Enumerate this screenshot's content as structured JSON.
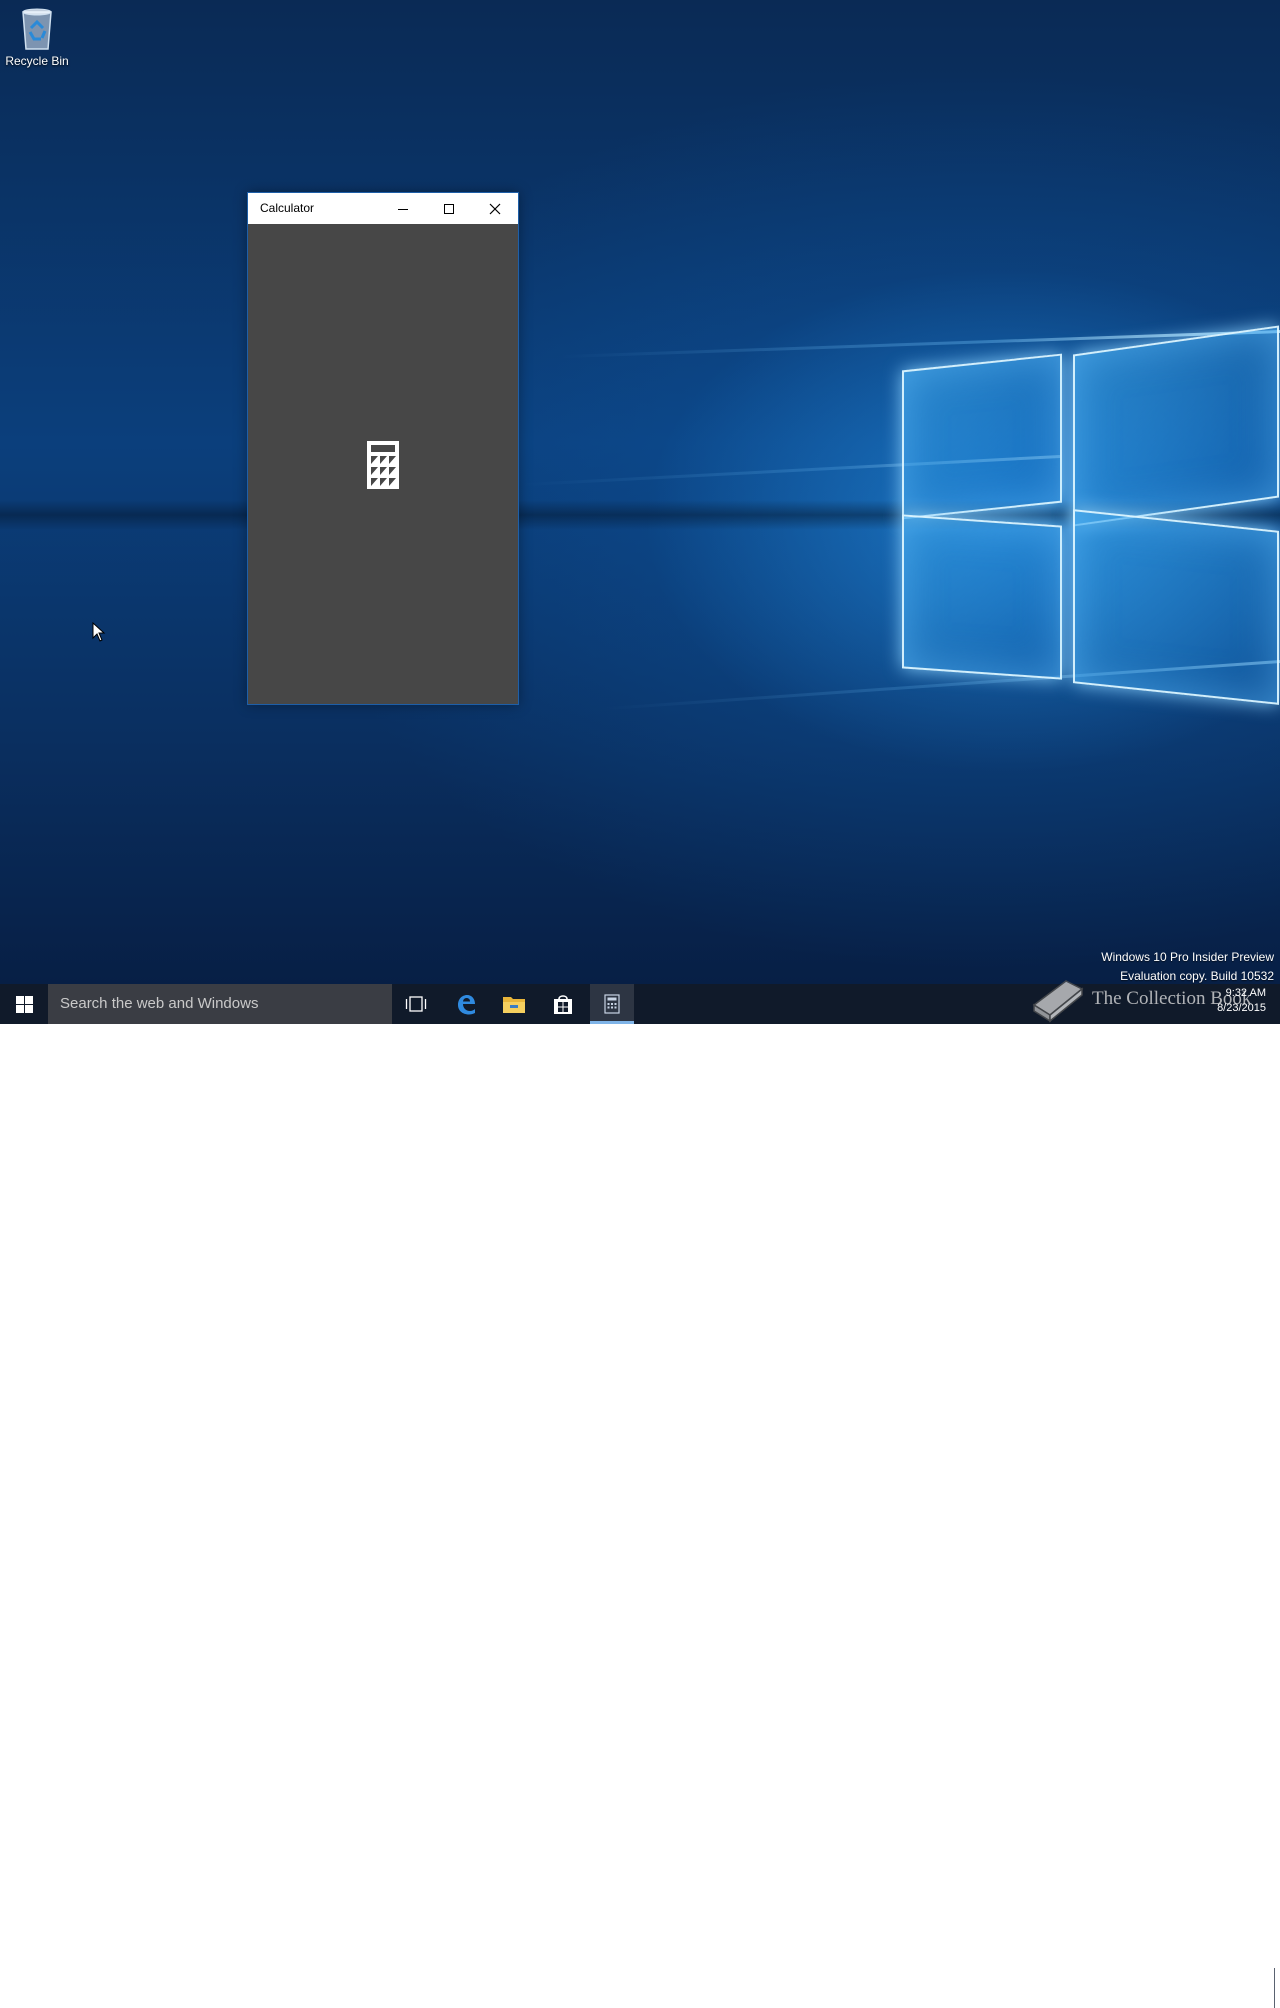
{
  "desktop": {
    "icons": [
      {
        "label": "Recycle Bin",
        "icon": "recycle-bin-icon"
      }
    ],
    "watermark": {
      "line1": "Windows 10 Pro Insider Preview",
      "line2": "Evaluation copy. Build 10532"
    }
  },
  "window": {
    "title": "Calculator",
    "minimize_icon": "minimize-icon",
    "maximize_icon": "maximize-icon",
    "close_icon": "close-icon",
    "splash_icon": "calculator-icon",
    "colors": {
      "body": "#474747",
      "titlebar": "#ffffff",
      "border": "#1e5fa8"
    }
  },
  "taskbar": {
    "start_icon": "windows-start-icon",
    "search_placeholder": "Search the web and Windows",
    "pinned": [
      {
        "name": "Task View",
        "icon": "task-view-icon"
      },
      {
        "name": "Microsoft Edge",
        "icon": "edge-icon"
      },
      {
        "name": "File Explorer",
        "icon": "folder-icon"
      },
      {
        "name": "Store",
        "icon": "store-icon"
      },
      {
        "name": "Calculator",
        "icon": "calculator-icon",
        "active": true
      }
    ],
    "overlay_text": "The Collection Book",
    "tray": {
      "icons": [
        "chevron-up-icon",
        "network-icon",
        "volume-icon",
        "action-center-icon"
      ],
      "time": "9:32 AM",
      "date": "8/23/2015"
    },
    "colors": {
      "taskbar": "#101a2a",
      "search": "#3a3d44",
      "active_underline": "#7fb4e8"
    }
  }
}
